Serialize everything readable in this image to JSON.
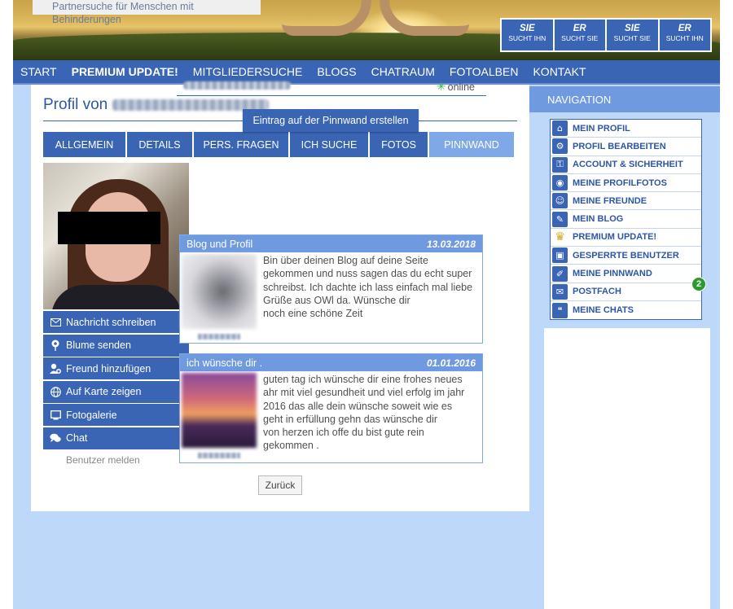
{
  "header": {
    "tagline": "Partnersuche für Menschen mit Behinderungen",
    "search_buttons": [
      {
        "line1": "SIE",
        "line2": "SUCHT IHN"
      },
      {
        "line1": "ER",
        "line2": "SUCHT SIE"
      },
      {
        "line1": "SIE",
        "line2": "SUCHT SIE"
      },
      {
        "line1": "ER",
        "line2": "SUCHT IHN"
      }
    ]
  },
  "topnav": {
    "items": [
      "START",
      "PREMIUM UPDATE!",
      "MITGLIEDERSUCHE",
      "BLOGS",
      "CHATRAUM",
      "FOTOALBEN",
      "KONTAKT"
    ]
  },
  "profile": {
    "title_prefix": "Profil von",
    "tabs": [
      "ALLGEMEIN",
      "DETAILS",
      "PERS. FRAGEN",
      "ICH SUCHE",
      "FOTOS",
      "PINNWAND"
    ],
    "active_tab": "PINNWAND",
    "actions": [
      {
        "label": "Nachricht schreiben",
        "icon": "envelope-icon"
      },
      {
        "label": "Blume senden",
        "icon": "flower-icon"
      },
      {
        "label": "Freund hinzufügen",
        "icon": "add-friend-icon"
      },
      {
        "label": "Auf Karte zeigen",
        "icon": "globe-icon"
      },
      {
        "label": "Fotogalerie",
        "icon": "monitor-icon"
      },
      {
        "label": "Chat",
        "icon": "chat-bubbles-icon"
      }
    ],
    "report_link": "Benutzer melden"
  },
  "pinnwand": {
    "status": "online",
    "new_entry_button": "Eintrag auf der Pinnwand erstellen",
    "posts": [
      {
        "title": "Blog und Profil",
        "date": "13.03.2018",
        "lines": [
          "Bin über deinen Blog auf deine Seite",
          "gekommen und nuss sagen das du echt super",
          "schreibst. Ich dachte ich lass einfach mal liebe",
          "Grüße aus OWl da. Wünsche dir",
          "noch eine schöne Zeit"
        ]
      },
      {
        "title": "ich wünsche dir .",
        "date": "01.01.2016",
        "lines": [
          "guten tag ich wünsche dir eine frohes neues",
          "ahr mit viel gesundheit und viel erfolg im jahr",
          "2016 das alle dein wünsche soweit wie es",
          "geht in erfüllung gehn das wünsche dir",
          "von herzen ich offe du bist gute rein",
          "gekommen ."
        ]
      }
    ],
    "back_button": "Zurück"
  },
  "sidebar": {
    "title": "NAVIGATION",
    "items": [
      {
        "label": "MEIN PROFIL",
        "icon": "home-icon"
      },
      {
        "label": "PROFIL BEARBEITEN",
        "icon": "gears-icon"
      },
      {
        "label": "ACCOUNT & SICHERHEIT",
        "icon": "key-icon"
      },
      {
        "label": "MEINE PROFILFOTOS",
        "icon": "camera-icon"
      },
      {
        "label": "MEINE FREUNDE",
        "icon": "friends-icon"
      },
      {
        "label": "MEIN BLOG",
        "icon": "blog-icon"
      },
      {
        "label": "PREMIUM UPDATE!",
        "icon": "crown-icon"
      },
      {
        "label": "GESPERRTE BENUTZER",
        "icon": "lock-icon"
      },
      {
        "label": "MEINE PINNWAND",
        "icon": "pin-icon"
      },
      {
        "label": "POSTFACH",
        "icon": "envelope-icon"
      },
      {
        "label": "MEINE CHATS",
        "icon": "chat-bubbles-icon"
      }
    ],
    "postfach_badge": "2"
  },
  "colors": {
    "primary": "#3a64b4",
    "light_primary": "#6f9ae0",
    "background": "#bdd8f8",
    "online_green": "#39b24a",
    "badge_green": "#2c9a2c"
  }
}
